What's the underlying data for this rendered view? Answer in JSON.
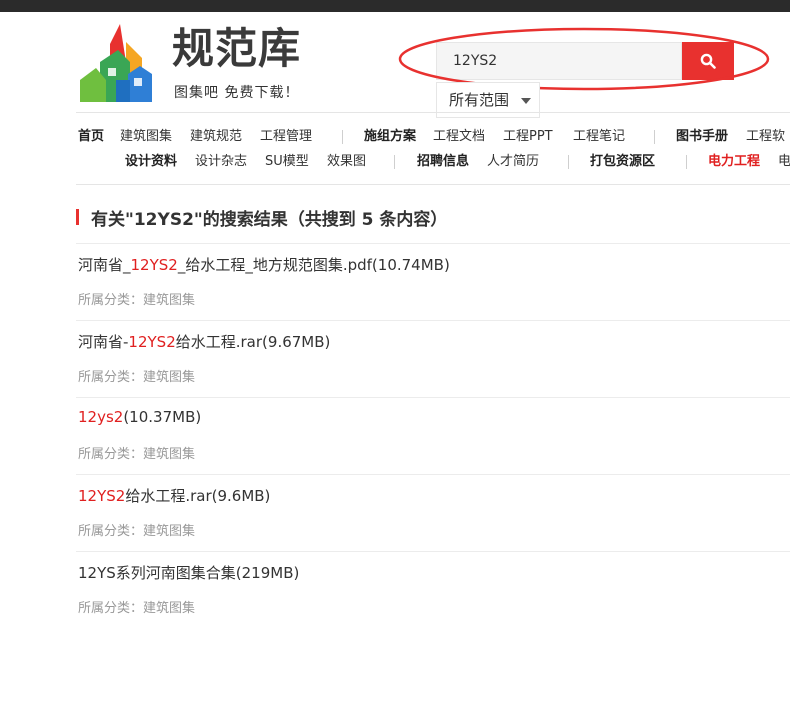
{
  "logo": {
    "title": "规范库",
    "tagline": "图集吧 免费下载！"
  },
  "search": {
    "value": "12YS2",
    "scope": "所有范围",
    "search_icon": "search-icon"
  },
  "nav": {
    "row1": [
      "首页",
      "建筑图集",
      "建筑规范",
      "工程管理",
      "施组方案",
      "工程文档",
      "工程PPT",
      "工程笔记",
      "图书手册",
      "工程软"
    ],
    "row2": [
      "设计资料",
      "设计杂志",
      "SU模型",
      "效果图",
      "招聘信息",
      "人才简历",
      "打包资源区",
      "电力工程",
      "电"
    ]
  },
  "results_header": "有关\"12YS2\"的搜索结果（共搜到 5 条内容）",
  "results": [
    {
      "pre": "河南省_",
      "hl": "12YS2",
      "post": "_给水工程_地方规范图集.pdf(10.74MB)",
      "category": "所属分类：建筑图集"
    },
    {
      "pre": "河南省-",
      "hl": "12YS2",
      "post": "给水工程.rar(9.67MB)",
      "category": "所属分类：建筑图集"
    },
    {
      "pre": "",
      "hl": "12ys2",
      "post": "(10.37MB)",
      "category": "所属分类：建筑图集"
    },
    {
      "pre": "",
      "hl": "12YS2",
      "post": "给水工程.rar(9.6MB)",
      "category": "所属分类：建筑图集"
    },
    {
      "pre": "12YS系列河南图集合集(219MB)",
      "hl": "",
      "post": "",
      "category": "所属分类：建筑图集"
    }
  ],
  "colors": {
    "accent": "#e8312f",
    "highlight": "#e02020",
    "annotation": "#e8312f"
  }
}
